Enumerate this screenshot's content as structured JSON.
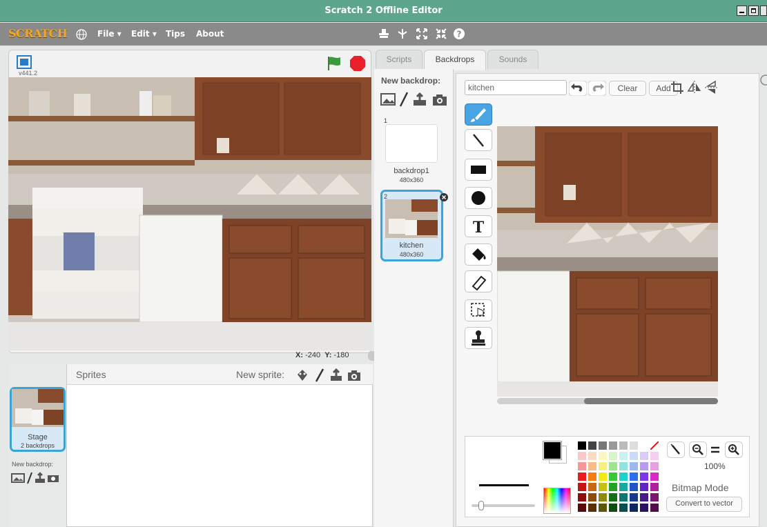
{
  "window": {
    "title": "Scratch 2 Offline Editor"
  },
  "menubar": {
    "logo": "SCRATCH",
    "file": "File ▾",
    "edit": "Edit ▾",
    "tips": "Tips",
    "about": "About"
  },
  "stage": {
    "version": "v441.2",
    "coords_x_label": "X:",
    "coords_x": "-240",
    "coords_y_label": "Y:",
    "coords_y": "-180"
  },
  "sprites_pane": {
    "header": "Sprites",
    "new_sprite_label": "New sprite:",
    "stage_label": "Stage",
    "stage_sub": "2 backdrops",
    "new_backdrop_label": "New backdrop:"
  },
  "tabs": [
    {
      "label": "Scripts"
    },
    {
      "label": "Backdrops"
    },
    {
      "label": "Sounds"
    }
  ],
  "backdrops": {
    "new_backdrop_label": "New backdrop:",
    "items": [
      {
        "index": "1",
        "name": "backdrop1",
        "size": "480x360"
      },
      {
        "index": "2",
        "name": "kitchen",
        "size": "480x360"
      }
    ]
  },
  "editor": {
    "name_value": "kitchen",
    "clear_label": "Clear",
    "add_label": "Add",
    "zoom": "100%",
    "mode": "Bitmap Mode",
    "convert_label": "Convert to vector"
  },
  "colors": {
    "accent": "#49a4e4",
    "titlebar": "#5ea58d",
    "menubar": "#8a8a8a",
    "stop": "#e8202a",
    "flag": "#2f8a2f"
  }
}
